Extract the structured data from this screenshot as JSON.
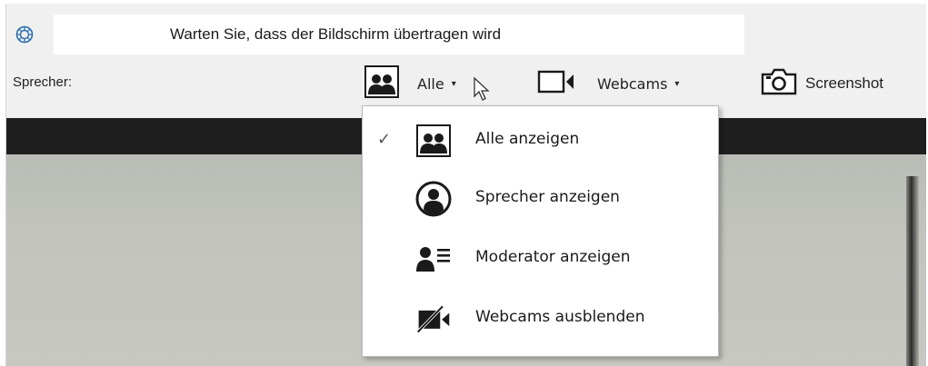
{
  "window": {
    "title": "Warten Sie, dass der Bildschirm übertragen wird",
    "app_icon": "app-logo-icon"
  },
  "toolbar": {
    "speaker_label": "Sprecher:",
    "layout_button": {
      "label": "Alle",
      "icon": "people-icon",
      "caret": "▾"
    },
    "webcams_button": {
      "label": "Webcams",
      "icon": "video-camera-icon",
      "caret": "▾"
    },
    "screenshot_button": {
      "label": "Screenshot",
      "icon": "camera-icon"
    }
  },
  "dropdown": {
    "items": [
      {
        "label": "Alle anzeigen",
        "icon": "people-icon",
        "checked": true,
        "check": "✓"
      },
      {
        "label": "Sprecher anzeigen",
        "icon": "user-circle-icon",
        "checked": false
      },
      {
        "label": "Moderator anzeigen",
        "icon": "moderator-icon",
        "checked": false
      },
      {
        "label": "Webcams ausblenden",
        "icon": "video-off-icon",
        "checked": false
      }
    ]
  },
  "colors": {
    "toolbar_bg": "#f0f0f0",
    "dark_bar": "#1f1f1f",
    "video_bg": "#c2c4bd",
    "icon_dark": "#1a1a1a"
  }
}
